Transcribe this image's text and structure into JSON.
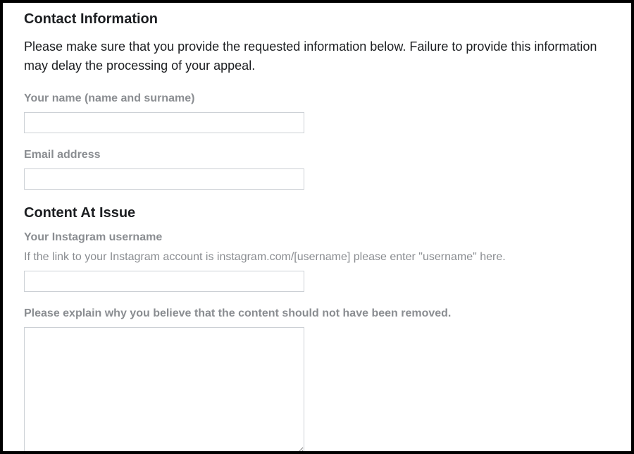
{
  "contact": {
    "heading": "Contact Information",
    "description": "Please make sure that you provide the requested information below. Failure to provide this information may delay the processing of your appeal.",
    "name_label": "Your name (name and surname)",
    "name_value": "",
    "email_label": "Email address",
    "email_value": ""
  },
  "content_issue": {
    "heading": "Content At Issue",
    "username_label": "Your Instagram username",
    "username_hint": "If the link to your Instagram account is instagram.com/[username] please enter \"username\" here.",
    "username_value": "",
    "explain_label": "Please explain why you believe that the content should not have been removed.",
    "explain_value": ""
  }
}
